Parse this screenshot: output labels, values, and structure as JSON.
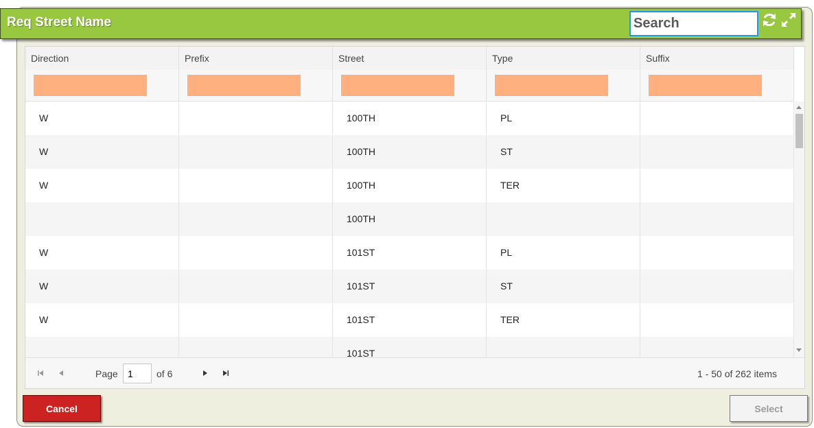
{
  "dialog": {
    "title": "Req Street Name",
    "search_placeholder": "Search",
    "icons": [
      "refresh-icon",
      "expand-icon"
    ]
  },
  "grid": {
    "columns": [
      "Direction",
      "Prefix",
      "Street",
      "Type",
      "Suffix"
    ],
    "rows": [
      [
        "W",
        "",
        "100TH",
        "PL",
        ""
      ],
      [
        "W",
        "",
        "100TH",
        "ST",
        ""
      ],
      [
        "W",
        "",
        "100TH",
        "TER",
        ""
      ],
      [
        "",
        "",
        "100TH",
        "",
        ""
      ],
      [
        "W",
        "",
        "101ST",
        "PL",
        ""
      ],
      [
        "W",
        "",
        "101ST",
        "ST",
        ""
      ],
      [
        "W",
        "",
        "101ST",
        "TER",
        ""
      ],
      [
        "",
        "",
        "101ST",
        "",
        ""
      ]
    ]
  },
  "pager": {
    "page_label": "Page",
    "page_value": "1",
    "of_label": "of 6",
    "items_label": "1 - 50 of 262 items"
  },
  "footer": {
    "cancel_label": "Cancel",
    "select_label": "Select"
  },
  "colors": {
    "header": "#97c83f",
    "filter": "#ffb07e",
    "cancel": "#cc2222"
  }
}
